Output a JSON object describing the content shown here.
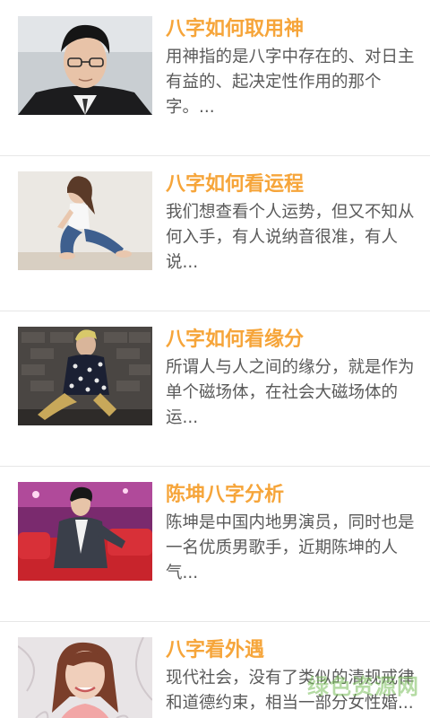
{
  "articles": [
    {
      "title": "八字如何取用神",
      "summary": "用神指的是八字中存在的、对日主有益的、起决定性作用的那个字。...",
      "thumb_icon": "man-with-glasses-photo"
    },
    {
      "title": "八字如何看运程",
      "summary": "我们想查看个人运势，但又不知从何入手，有人说纳音很准，有人说...",
      "thumb_icon": "woman-sitting-photo"
    },
    {
      "title": "八字如何看缘分",
      "summary": "所谓人与人之间的缘分，就是作为单个磁场体，在社会大磁场体的运...",
      "thumb_icon": "man-sitting-photo"
    },
    {
      "title": "陈坤八字分析",
      "summary": "陈坤是中国内地男演员，同时也是一名优质男歌手，近期陈坤的人气...",
      "thumb_icon": "man-on-sofa-photo"
    },
    {
      "title": "八字看外遇",
      "summary": "现代社会，没有了类似的清规戒律和道德约束，相当一部分女性婚...",
      "thumb_icon": "smiling-woman-photo"
    }
  ],
  "watermark": "绿色资源网",
  "colors": {
    "title": "#f6a53a",
    "summary": "#5a5a5a",
    "divider": "#e7e7e7"
  }
}
